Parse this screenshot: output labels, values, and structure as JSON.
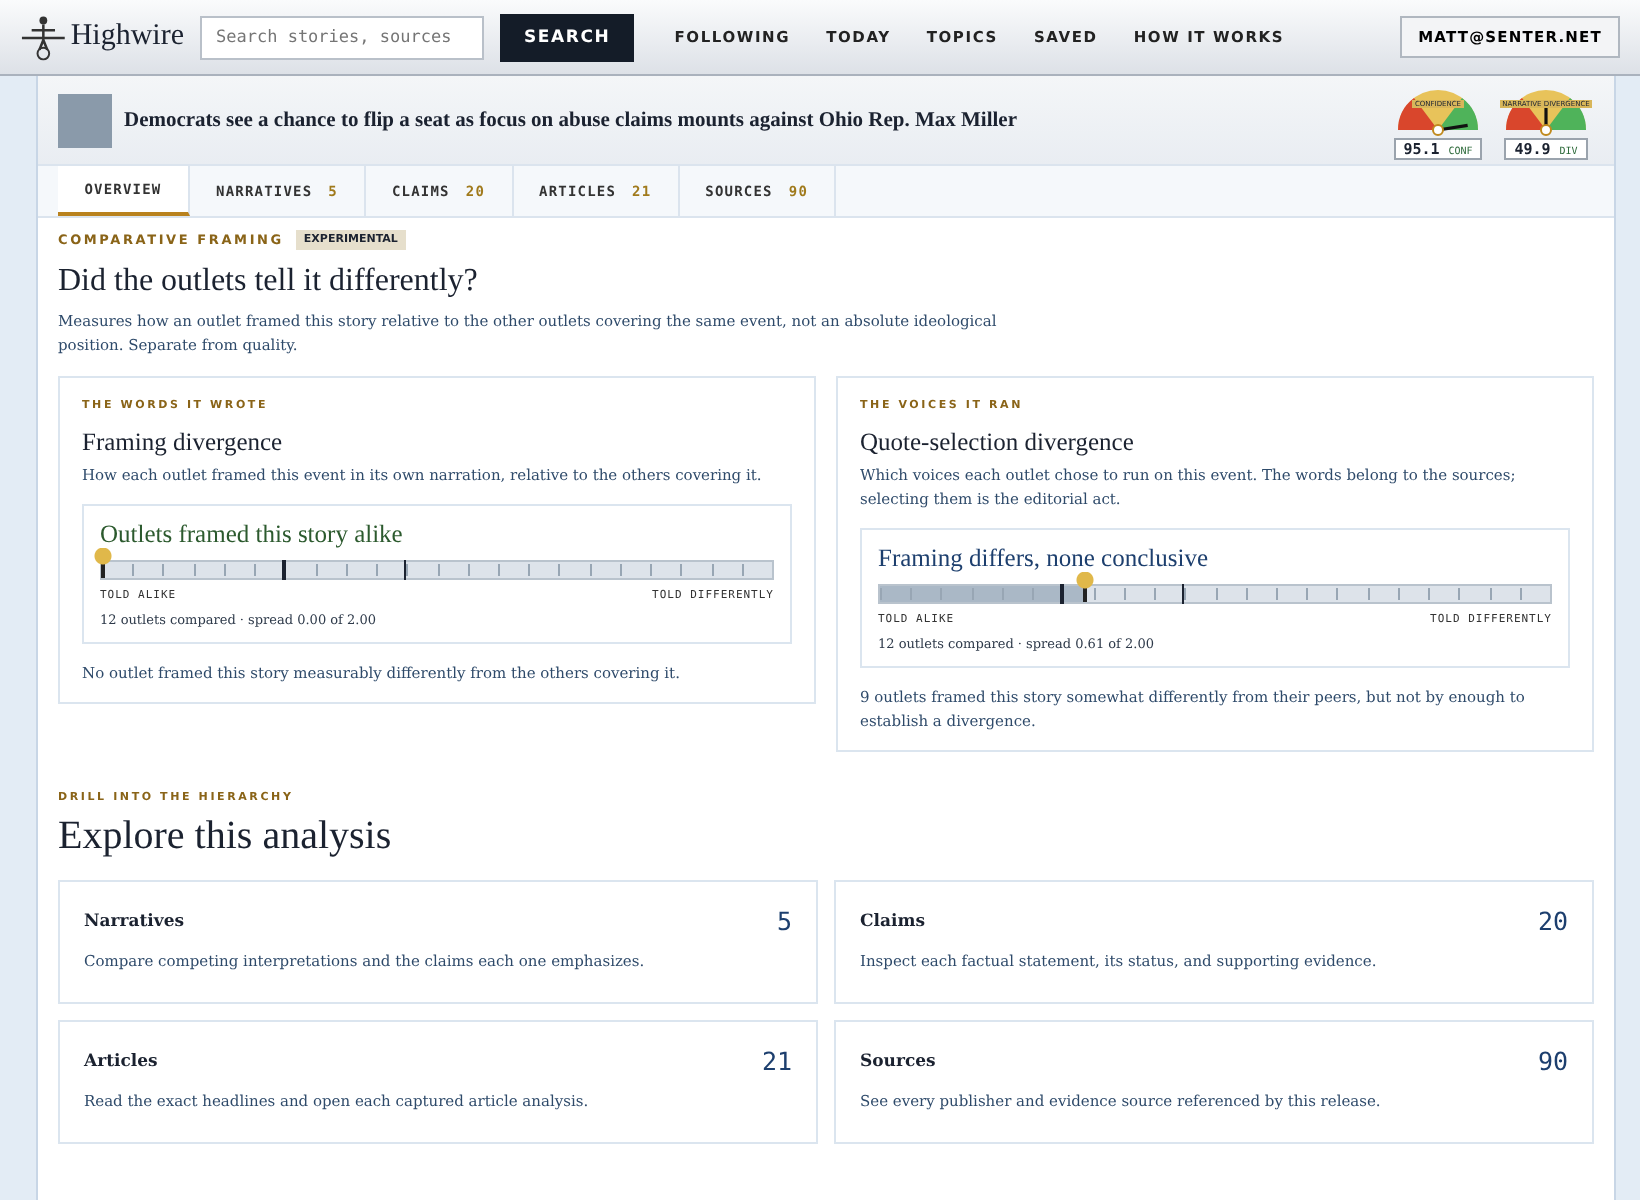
{
  "header": {
    "brand": "Highwire",
    "search": {
      "placeholder": "Search stories, sources"
    },
    "search_button": "SEARCH",
    "nav": [
      "FOLLOWING",
      "TODAY",
      "TOPICS",
      "SAVED",
      "HOW IT WORKS"
    ],
    "account": "MATT@SENTER.NET"
  },
  "story": {
    "title": "Democrats see a chance to flip a seat as focus on abuse claims mounts against Ohio Rep. Max Miller",
    "gauges": [
      {
        "label": "CONFIDENCE",
        "value": "95.1",
        "unit": "CONF"
      },
      {
        "label": "NARRATIVE DIVERGENCE",
        "value": "49.9",
        "unit": "DIV"
      }
    ]
  },
  "tabs": [
    {
      "label": "OVERVIEW",
      "selected": true
    },
    {
      "label": "NARRATIVES",
      "count": "5",
      "selected": false
    },
    {
      "label": "CLAIMS",
      "count": "20",
      "selected": false
    },
    {
      "label": "ARTICLES",
      "count": "21",
      "selected": false
    },
    {
      "label": "SOURCES",
      "count": "90",
      "selected": false
    }
  ],
  "framing": {
    "eyebrow": "COMPARATIVE FRAMING",
    "badge": "EXPERIMENTAL",
    "title": "Did the outlets tell it differently?",
    "description": "Measures how an outlet framed this story relative to the other outlets covering the same event, not an absolute ideological position. Separate from quality.",
    "panels": [
      {
        "eyebrow": "THE WORDS IT WROTE",
        "title": "Framing divergence",
        "description": "How each outlet framed this event in its own narration, relative to the others covering it.",
        "verdict": "Outlets framed this story alike",
        "kind": "alike",
        "level": 0,
        "min_label": "TOLD ALIKE",
        "max_label": "TOLD DIFFERENTLY",
        "stats": "12 outlets compared · spread 0.00 of 2.00",
        "summary": "No outlet framed this story measurably differently from the others covering it."
      },
      {
        "eyebrow": "THE VOICES IT RAN",
        "title": "Quote-selection divergence",
        "description": "Which voices each outlet chose to run on this event. The words belong to the sources; selecting them is the editorial act.",
        "verdict": "Framing differs, none conclusive",
        "kind": "differs",
        "level": 0.305,
        "min_label": "TOLD ALIKE",
        "max_label": "TOLD DIFFERENTLY",
        "stats": "12 outlets compared · spread 0.61 of 2.00",
        "summary": "9 outlets framed this story somewhat differently from their peers, but not by enough to establish a divergence."
      }
    ]
  },
  "explore": {
    "eyebrow": "DRILL INTO THE HIERARCHY",
    "title": "Explore this analysis",
    "cards": [
      {
        "title": "Narratives",
        "count": "5",
        "description": "Compare competing interpretations and the claims each one emphasizes."
      },
      {
        "title": "Claims",
        "count": "20",
        "description": "Inspect each factual statement, its status, and supporting evidence."
      },
      {
        "title": "Articles",
        "count": "21",
        "description": "Read the exact headlines and open each captured article analysis."
      },
      {
        "title": "Sources",
        "count": "90",
        "description": "See every publisher and evidence source referenced by this release."
      }
    ]
  }
}
